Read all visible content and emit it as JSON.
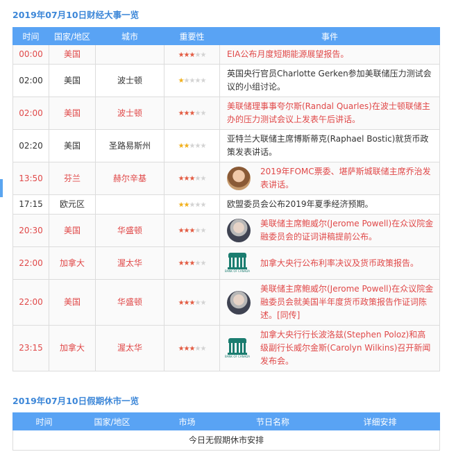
{
  "events_title": "2019年07月10日财经大事一览",
  "holiday_title": "2019年07月10日假期休市一览",
  "events_headers": [
    "时间",
    "国家/地区",
    "城市",
    "重要性",
    "事件"
  ],
  "holiday_headers": [
    "时间",
    "国家/地区",
    "市场",
    "节日名称",
    "详细安排"
  ],
  "holiday_empty": "今日无假期休市安排",
  "logo_caption": "BANK OF CANADA",
  "events": [
    {
      "time": "00:00",
      "country": "美国",
      "city": "",
      "importance": 3,
      "highlight": true,
      "icon": "",
      "text": "EIA公布月度短期能源展望报告。"
    },
    {
      "time": "02:00",
      "country": "美国",
      "city": "波士顿",
      "importance": 1,
      "highlight": false,
      "icon": "",
      "text": "英国央行官员Charlotte Gerken参加美联储压力测试会议的小组讨论。"
    },
    {
      "time": "02:00",
      "country": "美国",
      "city": "波士顿",
      "importance": 3,
      "highlight": true,
      "icon": "",
      "text": "美联储理事事夸尔斯(Randal Quarles)在波士顿联储主办的压力测试会议上发表午后讲话。"
    },
    {
      "time": "02:20",
      "country": "美国",
      "city": "圣路易斯州",
      "importance": 2,
      "highlight": false,
      "icon": "",
      "text": "亚特兰大联储主席博斯蒂克(Raphael Bostic)就货币政策发表讲话。"
    },
    {
      "time": "13:50",
      "country": "芬兰",
      "city": "赫尔辛基",
      "importance": 3,
      "highlight": true,
      "icon": "person-portrait",
      "text": "2019年FOMC票委、堪萨斯城联储主席乔治发表讲话。"
    },
    {
      "time": "17:15",
      "country": "欧元区",
      "city": "",
      "importance": 2,
      "highlight": false,
      "icon": "",
      "text": "欧盟委员会公布2019年夏季经济预期。"
    },
    {
      "time": "20:30",
      "country": "美国",
      "city": "华盛顿",
      "importance": 3,
      "highlight": true,
      "icon": "powell-portrait",
      "text": "美联储主席鲍威尔(Jerome Powell)在众议院金融委员会的证词讲稿提前公布。"
    },
    {
      "time": "22:00",
      "country": "加拿大",
      "city": "渥太华",
      "importance": 3,
      "highlight": true,
      "icon": "bank-of-canada-logo",
      "text": "加拿大央行公布利率决议及货币政策报告。"
    },
    {
      "time": "22:00",
      "country": "美国",
      "city": "华盛顿",
      "importance": 3,
      "highlight": true,
      "icon": "powell-portrait",
      "text": "美联储主席鲍威尔(Jerome Powell)在众议院金融委员会就美国半年度货币政策报告作证词陈述。[同传]"
    },
    {
      "time": "23:15",
      "country": "加拿大",
      "city": "渥太华",
      "importance": 3,
      "highlight": true,
      "icon": "bank-of-canada-logo",
      "text": "加拿大央行行长波洛兹(Stephen Poloz)和高级副行长威尔金斯(Carolyn Wilkins)召开新闻发布会。"
    }
  ],
  "colors": {
    "accent": "#59a3f4",
    "title": "#3d87d8",
    "highlight_text": "#e04848",
    "star_high": "#e35b42",
    "star_low": "#f1b01c"
  }
}
